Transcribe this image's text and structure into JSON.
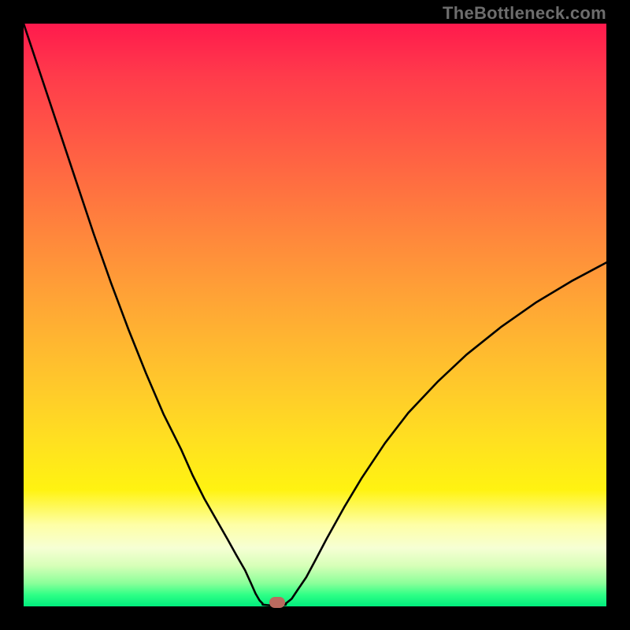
{
  "watermark": "TheBottleneck.com",
  "colors": {
    "frame": "#000000",
    "gradient_top": "#ff1a4d",
    "gradient_bottom": "#00ed7d",
    "curve": "#000000",
    "marker": "#ba6a5f"
  },
  "chart_data": {
    "type": "line",
    "title": "",
    "xlabel": "",
    "ylabel": "",
    "xlim": [
      0,
      100
    ],
    "ylim": [
      0,
      100
    ],
    "series": [
      {
        "name": "left-branch",
        "x": [
          0,
          3,
          6,
          9,
          12,
          15,
          18,
          21,
          24,
          27,
          29,
          31,
          33,
          35,
          36.5,
          38,
          39,
          39.8,
          40.5,
          41
        ],
        "y": [
          100,
          91,
          82,
          73,
          64,
          55.5,
          47.5,
          40,
          33,
          27,
          22.5,
          18.5,
          15,
          11.5,
          8.8,
          6.2,
          4,
          2.2,
          1,
          0.5
        ]
      },
      {
        "name": "floor",
        "x": [
          41,
          42,
          43,
          44,
          45
        ],
        "y": [
          0.3,
          0.2,
          0.2,
          0.2,
          0.3
        ]
      },
      {
        "name": "right-branch",
        "x": [
          45,
          46,
          47,
          48.5,
          50,
          52,
          55,
          58,
          62,
          66,
          71,
          76,
          82,
          88,
          94,
          100
        ],
        "y": [
          0.5,
          1.3,
          2.8,
          5,
          7.8,
          11.6,
          17,
          22,
          28,
          33.2,
          38.5,
          43.2,
          48,
          52.2,
          55.8,
          59
        ]
      }
    ],
    "marker": {
      "x": 43.5,
      "y": 0.7
    },
    "grid": false,
    "legend": false
  }
}
